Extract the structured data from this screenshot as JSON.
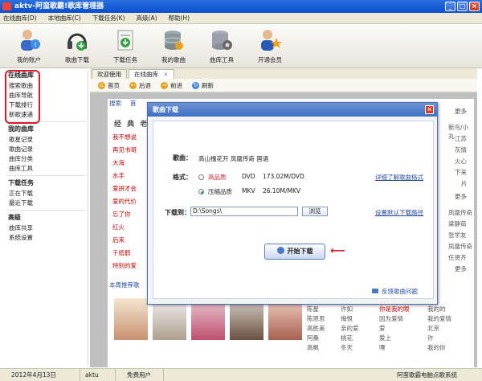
{
  "window": {
    "title": "aktv-阿蛮歌霸!歌库管理器",
    "minimize": "_",
    "maximize": "□",
    "close": "×"
  },
  "menu": [
    "在线曲库(D)",
    "本地曲库(C)",
    "下载任务(K)",
    "高级(A)",
    "帮助(H)"
  ],
  "toolbar": [
    {
      "label": "我的账户",
      "icon": "user-info-icon"
    },
    {
      "label": "歌曲下载",
      "icon": "headphones-icon"
    },
    {
      "label": "下载任务",
      "icon": "download-task-icon"
    },
    {
      "label": "我的歌曲",
      "icon": "database-icon"
    },
    {
      "label": "曲库工具",
      "icon": "gear-database-icon"
    },
    {
      "label": "开通会员",
      "icon": "vip-member-icon"
    }
  ],
  "sidebar": {
    "sections": [
      {
        "title": "在线曲库",
        "items": [
          "搜索歌曲",
          "曲库导航",
          "下载排行",
          "新歌速递"
        ]
      },
      {
        "title": "我的曲库",
        "items": [
          "歌星记录",
          "歌曲记录",
          "曲库分类",
          "曲库工具"
        ]
      },
      {
        "title": "下载任务",
        "items": [
          "正在下载",
          "最近下载"
        ]
      },
      {
        "title": "高级",
        "items": [
          "曲库共享",
          "系统设置"
        ]
      }
    ]
  },
  "tabs": [
    {
      "label": "欢迎使用"
    },
    {
      "label": "在线曲库",
      "close": "×"
    }
  ],
  "nav": {
    "home": "首页",
    "back": "后退",
    "forward": "前进",
    "refresh": "刷新"
  },
  "background": {
    "heading": "经 典 老",
    "top_links": [
      "搜索",
      "首"
    ],
    "songs": [
      "我不想说",
      "再见书哥",
      "大海",
      "水手",
      "爱拼才会",
      "爱的代价",
      "忘了你",
      "红火",
      "后来",
      "千纸鹤",
      "特别的爱"
    ],
    "recommend": "本周推荐歌",
    "right_items": [
      "更多",
      "新鸟/小丸",
      "江苏",
      "灰情",
      "火心",
      "下来",
      "片",
      "更多",
      "凤凰传奇",
      "梁静茹",
      "张学友",
      "凤凰传奇",
      "任贤齐",
      "更多"
    ],
    "bottom_artists": [
      "陈星",
      "陈思思",
      "高胜美",
      "阿桑",
      "高枫"
    ],
    "bottom_songs": [
      "许如",
      "悔恨",
      "亲的爱",
      "桃花",
      "冬天"
    ],
    "bottom_right": [
      "你是我的眼",
      "因为爱情",
      "爱",
      "爱上",
      "嘿",
      "我的的",
      "我的爱情",
      "北京",
      "许",
      "我的你"
    ]
  },
  "dialog": {
    "title": "歌曲下载",
    "close": "×",
    "song_label": "歌曲：",
    "song_value": "高山槐花开 凤凰传奇 国语",
    "format_label": "格式：",
    "options": [
      {
        "label": "高品质",
        "type": "DVD",
        "size": "173.02M/DVD",
        "selected": false
      },
      {
        "label": "压缩品质",
        "type": "MKV",
        "size": "26.10M/MKV",
        "selected": true
      }
    ],
    "format_link": "详细了解歌曲格式",
    "path_label": "下载到：",
    "path_value": "D:\\Songs\\",
    "browse": "浏览",
    "default_path_link": "设置默认下载路径",
    "start_button": "开始下载",
    "feedback_link": "反馈歌曲问题"
  },
  "status": {
    "date": "2012年4月13日",
    "user": "aktu",
    "user_type": "免费用户",
    "app_name": "阿蛮歌霸电脑点歌系统"
  },
  "colors": {
    "highlight_red": "#d81e2c",
    "title_blue": "#0a4fcf",
    "link_blue": "#2a4ea0"
  }
}
